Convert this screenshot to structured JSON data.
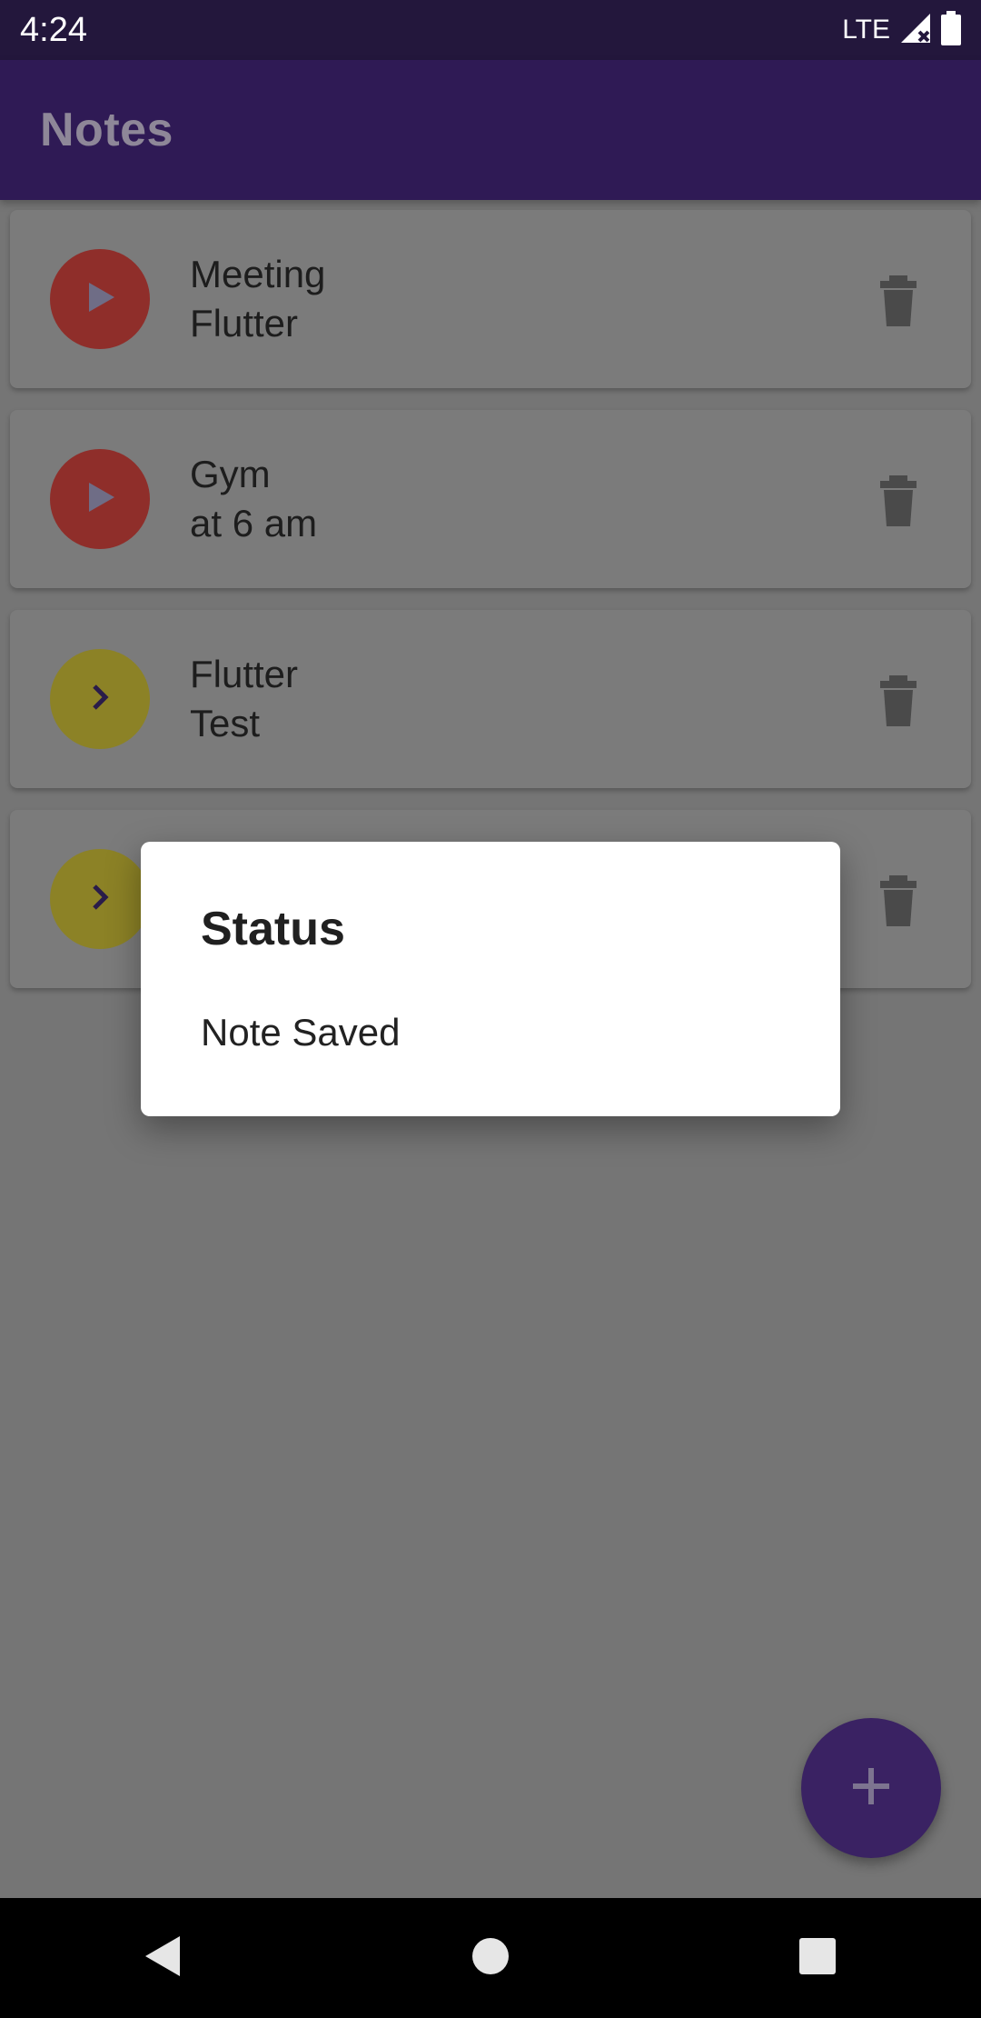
{
  "status_bar": {
    "time": "4:24",
    "network": "LTE"
  },
  "app_bar": {
    "title": "Notes"
  },
  "notes": [
    {
      "title": "Meeting",
      "description": "Flutter",
      "priority_icon": "play-icon",
      "priority_color": "#8f2e2a"
    },
    {
      "title": "Gym",
      "description": "at 6 am",
      "priority_icon": "play-icon",
      "priority_color": "#8f2e2a"
    },
    {
      "title": "Flutter",
      "description": "Test",
      "priority_icon": "chevron-right-icon",
      "priority_color": "#8c8226"
    },
    {
      "title": "",
      "description": "",
      "priority_icon": "chevron-right-icon",
      "priority_color": "#8c8226"
    }
  ],
  "dialog": {
    "title": "Status",
    "message": "Note Saved"
  },
  "fab": {
    "icon": "plus-icon"
  },
  "colors": {
    "app_bar": "#2f1a55",
    "fab": "#3a2263",
    "overlay": "#757575"
  }
}
